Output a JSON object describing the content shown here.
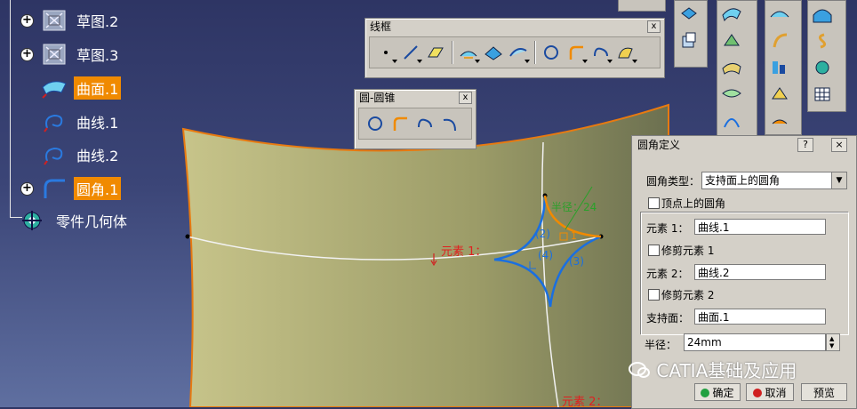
{
  "tree": {
    "items": [
      {
        "label": "草图.2",
        "icon": "sketch-icon",
        "expandable": true,
        "highlight": false
      },
      {
        "label": "草图.3",
        "icon": "sketch-icon",
        "expandable": true,
        "highlight": false
      },
      {
        "label": "曲面.1",
        "icon": "surface-icon",
        "expandable": false,
        "highlight": true
      },
      {
        "label": "曲线.1",
        "icon": "curve-icon",
        "expandable": false,
        "highlight": false
      },
      {
        "label": "曲线.2",
        "icon": "curve-icon",
        "expandable": false,
        "highlight": false
      },
      {
        "label": "圆角.1",
        "icon": "corner-icon",
        "expandable": true,
        "highlight": true
      },
      {
        "label": "零件几何体",
        "icon": "gear-icon",
        "expandable": false,
        "highlight": false
      }
    ]
  },
  "toolbar_wireframe": {
    "title": "线框",
    "close": "x"
  },
  "toolbar_circle": {
    "title": "圆-圆锥",
    "close": "x"
  },
  "viewport": {
    "label_elem1": "元素 1：",
    "label_radius": "半径：24",
    "label_elem2": "元素 2：",
    "label_2": "(2)",
    "label_4": "(4)",
    "label_3": "(3)",
    "label_1": "1",
    "colors": {
      "surface": "#b6b47a",
      "edge": "#e87a10",
      "curve": "#ffffff",
      "corner": "#1a6fe0",
      "accent": "#e0a030"
    }
  },
  "dialog": {
    "title": "圆角定义",
    "help": "?",
    "close": "×",
    "type_label": "圆角类型：",
    "type_value": "支持面上的圆角",
    "vertex_label": "顶点上的圆角",
    "elem1_label": "元素 1：",
    "elem1_value": "曲线.1",
    "trim1_label": "修剪元素 1",
    "elem2_label": "元素 2：",
    "elem2_value": "曲线.2",
    "trim2_label": "修剪元素 2",
    "support_label": "支持面：",
    "support_value": "曲面.1",
    "radius_label": "半径：",
    "radius_value": "24mm",
    "ok": "确定",
    "cancel": "取消",
    "preview": "预览"
  },
  "watermark": "CATIA基础及应用"
}
